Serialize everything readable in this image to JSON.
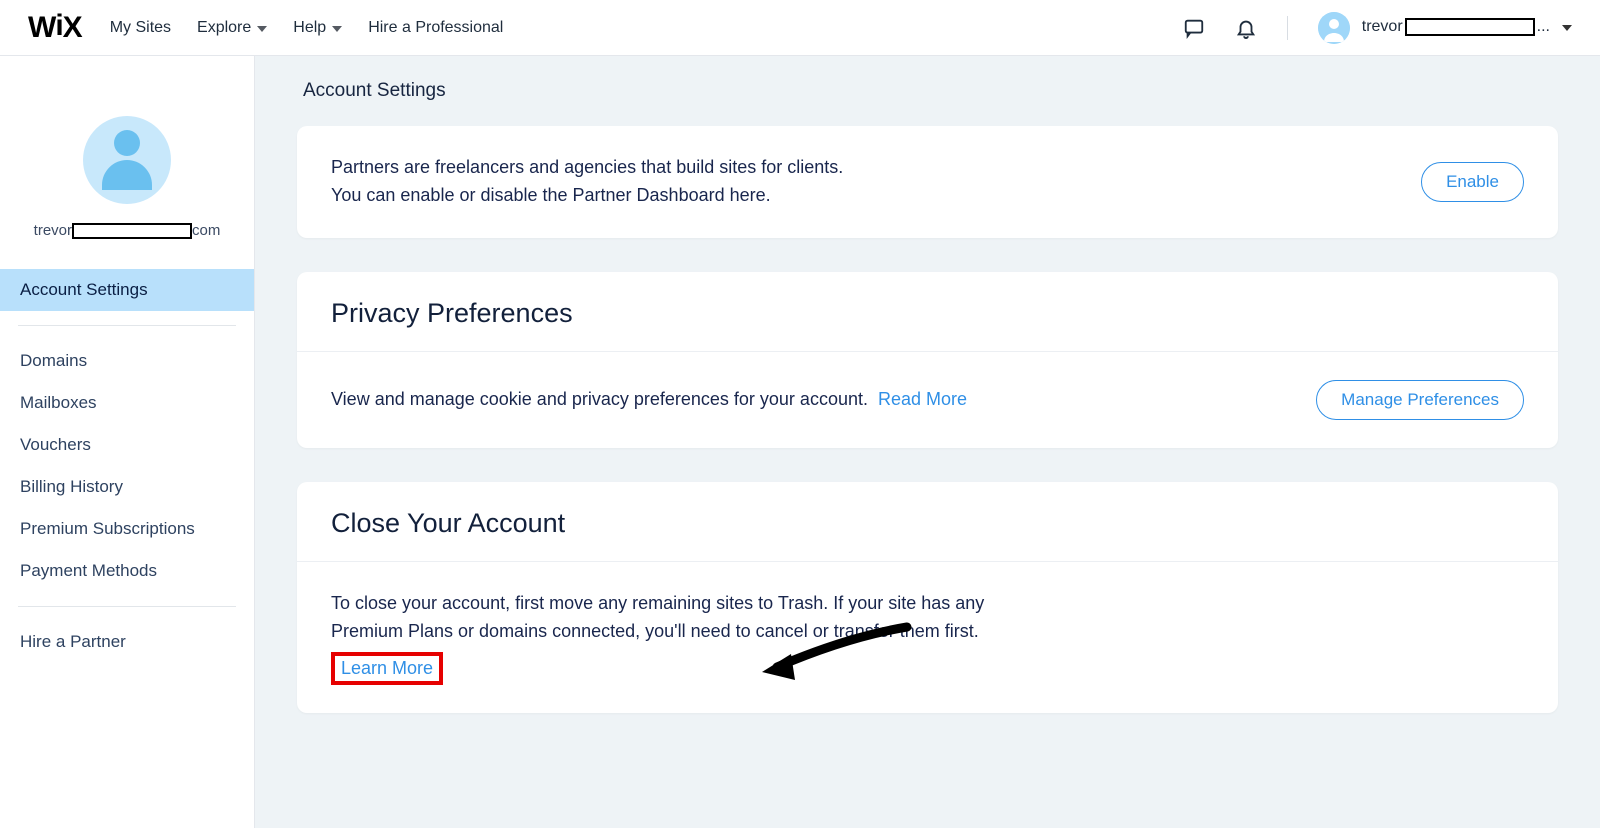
{
  "topnav": {
    "logo_text": "WiX",
    "items": [
      {
        "label": "My Sites",
        "has_chevron": false
      },
      {
        "label": "Explore",
        "has_chevron": true
      },
      {
        "label": "Help",
        "has_chevron": true
      },
      {
        "label": "Hire a Professional",
        "has_chevron": false
      }
    ],
    "user_prefix": "trevor",
    "user_suffix": "..."
  },
  "sidebar": {
    "email_prefix": "trevor",
    "email_suffix": "com",
    "items": [
      {
        "label": "Account Settings",
        "active": true
      },
      {
        "label": "Domains"
      },
      {
        "label": "Mailboxes"
      },
      {
        "label": "Vouchers"
      },
      {
        "label": "Billing History"
      },
      {
        "label": "Premium Subscriptions"
      },
      {
        "label": "Payment Methods"
      }
    ],
    "footer_item": "Hire a Partner"
  },
  "page": {
    "title": "Account Settings"
  },
  "partner_card": {
    "line1": "Partners are freelancers and agencies that build sites for clients.",
    "line2": "You can enable or disable the Partner Dashboard here.",
    "button": "Enable"
  },
  "privacy_card": {
    "title": "Privacy Preferences",
    "text": "View and manage cookie and privacy preferences for your account.",
    "read_more": "Read More",
    "button": "Manage Preferences"
  },
  "close_card": {
    "title": "Close Your Account",
    "text": "To close your account, first move any remaining sites to Trash. If your site has any Premium Plans or domains connected, you'll need to cancel or transfer them first.",
    "learn_more": "Learn More"
  }
}
